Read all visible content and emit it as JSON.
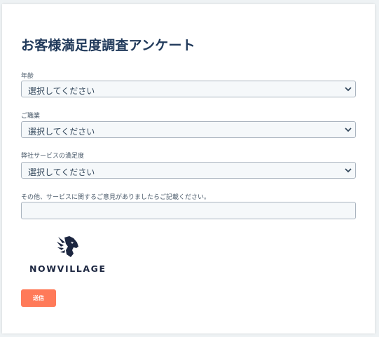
{
  "form": {
    "title": "お客様満足度調査アンケート",
    "fields": [
      {
        "label": "年齢",
        "value": "選択してください"
      },
      {
        "label": "ご職業",
        "value": "選択してください"
      },
      {
        "label": "弊社サービスの満足度",
        "value": "選択してください"
      }
    ],
    "comment_label": "その他、サービスに関するご意見がありましたらご記載ください。",
    "comment_value": "",
    "submit_label": "送信"
  },
  "logo": {
    "text": "NOWVILLAGE",
    "icon": "lion-head-icon"
  },
  "colors": {
    "title": "#213a5b",
    "submit_button": "#ff7a59",
    "field_background": "#f5f8fa",
    "logo": "#1c2640"
  }
}
